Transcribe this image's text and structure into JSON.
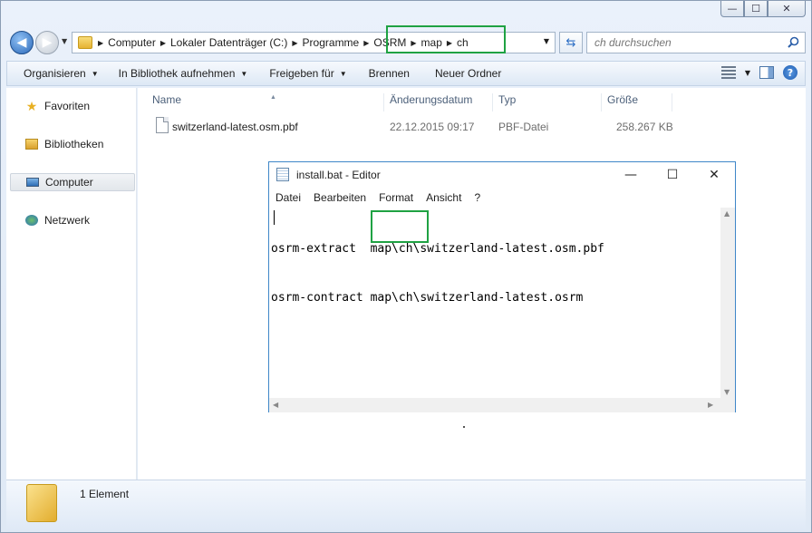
{
  "explorer": {
    "window_controls": {
      "minimize": "—",
      "maximize": "☐",
      "close": "✕"
    },
    "breadcrumbs": [
      "Computer",
      "Lokaler Datenträger (C:)",
      "Programme",
      "OSRM",
      "map",
      "ch"
    ],
    "search_placeholder": "ch durchsuchen",
    "toolbar": {
      "organize": "Organisieren",
      "include_library": "In Bibliothek aufnehmen",
      "share_with": "Freigeben für",
      "burn": "Brennen",
      "new_folder": "Neuer Ordner"
    },
    "sidebar": {
      "items": [
        {
          "label": "Favoriten",
          "icon": "star-icon"
        },
        {
          "label": "Bibliotheken",
          "icon": "library-icon"
        },
        {
          "label": "Computer",
          "icon": "computer-icon"
        },
        {
          "label": "Netzwerk",
          "icon": "network-icon"
        }
      ]
    },
    "columns": {
      "name": "Name",
      "modified": "Änderungsdatum",
      "type": "Typ",
      "size": "Größe"
    },
    "files": [
      {
        "name": "switzerland-latest.osm.pbf",
        "modified": "22.12.2015 09:17",
        "type": "PBF-Datei",
        "size": "258.267 KB"
      }
    ],
    "status": "1 Element",
    "highlight_color": "#1fa243"
  },
  "notepad": {
    "title": "install.bat - Editor",
    "menu": [
      "Datei",
      "Bearbeiten",
      "Format",
      "Ansicht",
      "?"
    ],
    "controls": {
      "minimize": "—",
      "maximize": "☐",
      "close": "✕"
    },
    "lines": [
      "osrm-extract  map\\ch\\switzerland-latest.osm.pbf",
      "osrm-contract map\\ch\\switzerland-latest.osrm"
    ]
  }
}
